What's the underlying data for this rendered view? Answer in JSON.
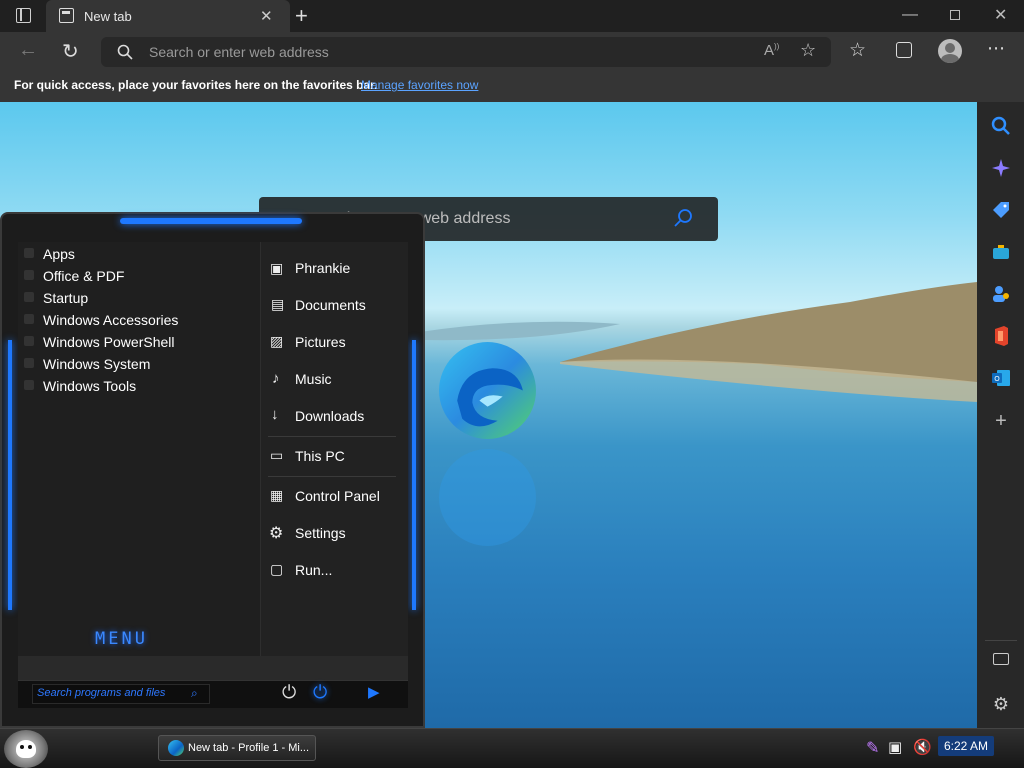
{
  "browser": {
    "tab_title": "New tab",
    "address_placeholder": "Search or enter web address",
    "favorites_bar": {
      "text": "For quick access, place your favorites here on the favorites bar.",
      "link": "Manage favorites now"
    },
    "ntp_search_placeholder": "Search or enter web address",
    "toolbar_icons": [
      "back-icon",
      "refresh-icon",
      "search-icon",
      "read-aloud-icon",
      "add-favorite-icon",
      "favorites-icon",
      "collections-icon",
      "profile-icon",
      "more-icon"
    ],
    "sidebar_icons": [
      "search-icon",
      "copilot-icon",
      "shopping-tag-icon",
      "tools-icon",
      "people-icon",
      "office-icon",
      "outlook-icon",
      "add-icon",
      "hide-sidebar-icon",
      "settings-icon"
    ],
    "window_controls": [
      "minimize-icon",
      "restore-icon",
      "close-icon"
    ]
  },
  "start_menu": {
    "left_items": [
      "Apps",
      "Office & PDF",
      "Startup",
      "Windows Accessories",
      "Windows PowerShell",
      "Windows System",
      "Windows Tools"
    ],
    "right_items": [
      "Phrankie",
      "Documents",
      "Pictures",
      "Music",
      "Downloads",
      "This PC",
      "Control Panel",
      "Settings",
      "Run..."
    ],
    "menu_label": "MENU",
    "search_placeholder": "Search programs and files"
  },
  "taskbar": {
    "task_label": "New tab - Profile 1 - Mi...",
    "clock": "6:22 AM"
  },
  "colors": {
    "accent": "#1e78ff",
    "link": "#5ba3ff",
    "chrome_dark": "#202020",
    "chrome_mid": "#353535"
  }
}
